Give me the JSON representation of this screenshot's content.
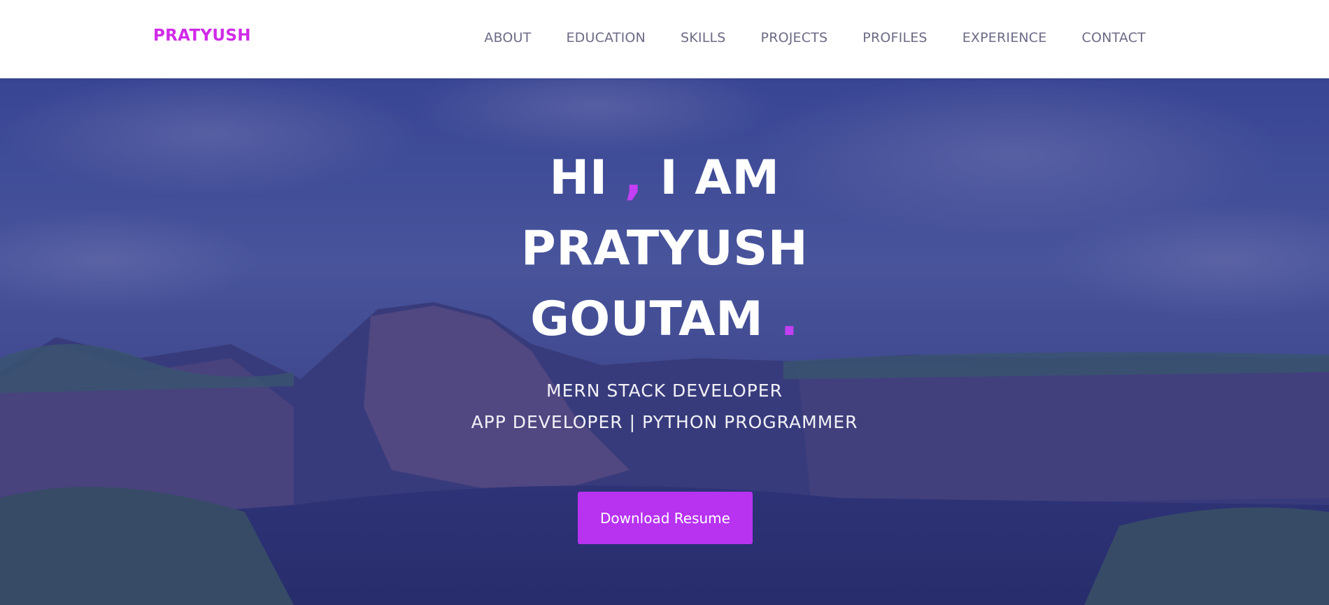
{
  "nav": {
    "brand": "PRATYUSH",
    "links": [
      "ABOUT",
      "EDUCATION",
      "SKILLS",
      "PROJECTS",
      "PROFILES",
      "EXPERIENCE",
      "CONTACT"
    ]
  },
  "hero": {
    "line1_a": "HI ",
    "line1_accent": ",",
    "line1_b": " I AM",
    "line2": "PRATYUSH",
    "line3_a": "GOUTAM ",
    "line3_accent": ".",
    "subtitle1": "MERN STACK DEVELOPER",
    "subtitle2": "APP DEVELOPER | PYTHON PROGRAMMER",
    "button_label": "Download Resume"
  },
  "colors": {
    "brand": "#d02be8",
    "accent": "#c23ff3",
    "button": "#b733f0",
    "nav_text": "#6b6b86"
  }
}
